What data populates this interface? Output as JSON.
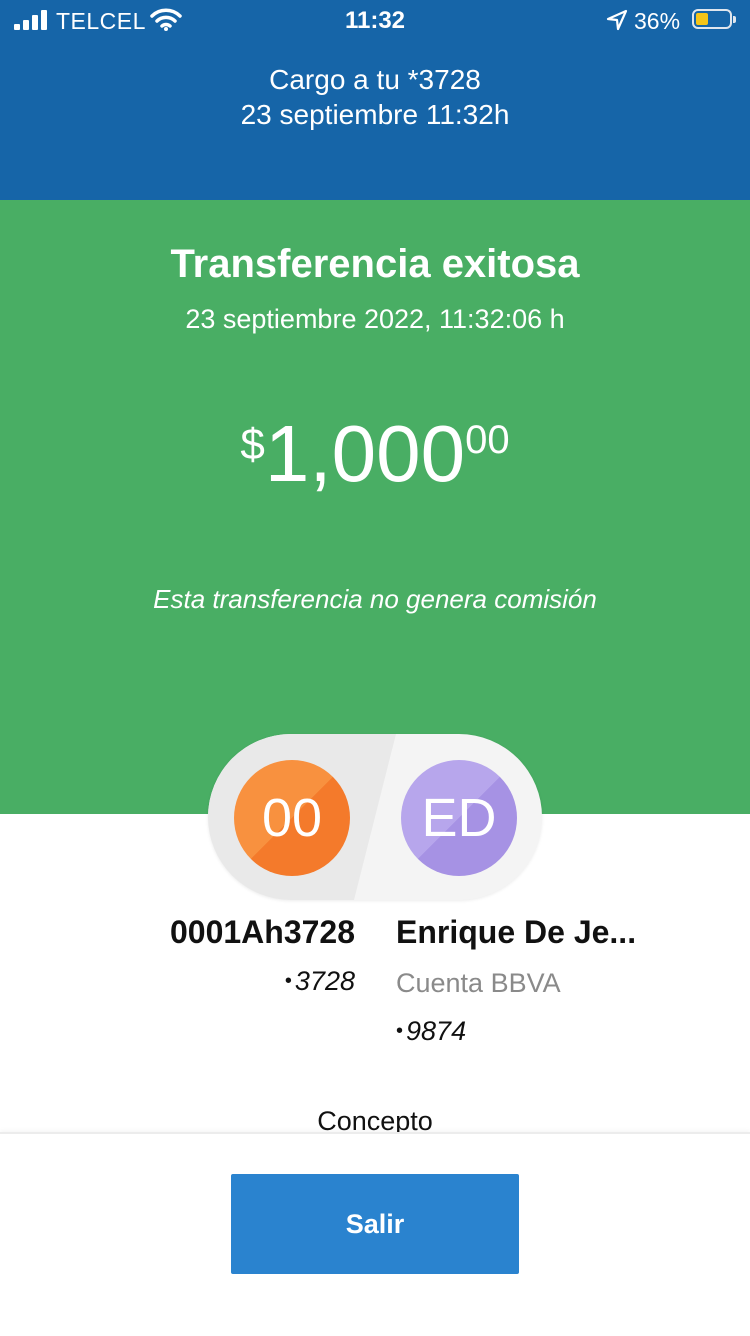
{
  "status_bar": {
    "carrier": "TELCEL",
    "time": "11:32",
    "battery_percent": "36%",
    "battery_level": 0.36,
    "icons": [
      "signal-icon",
      "wifi-icon",
      "location-arrow-icon",
      "battery-icon"
    ]
  },
  "header": {
    "charge_line": "Cargo a tu *3728",
    "datetime": "23 septiembre 11:32h"
  },
  "result": {
    "title": "Transferencia exitosa",
    "date": "23 septiembre 2022, 11:32:06 h",
    "amount_currency": "$",
    "amount_integer": "1,000",
    "amount_decimals": "00",
    "commission_note": "Esta transferencia no genera comisión"
  },
  "transfer": {
    "origin": {
      "initials": "00",
      "name": "0001Ah3728",
      "account": "3728"
    },
    "destination": {
      "initials": "ED",
      "name": "Enrique De Je...",
      "bank": "Cuenta BBVA",
      "account": "9874"
    },
    "concept_label": "Concepto"
  },
  "actions": {
    "exit_label": "Salir"
  },
  "colors": {
    "header_blue": "#1665a8",
    "success_green": "#49ae64",
    "origin_orange": "#f68a3a",
    "destination_purple": "#ae9de8",
    "button_blue": "#2a83cf"
  }
}
